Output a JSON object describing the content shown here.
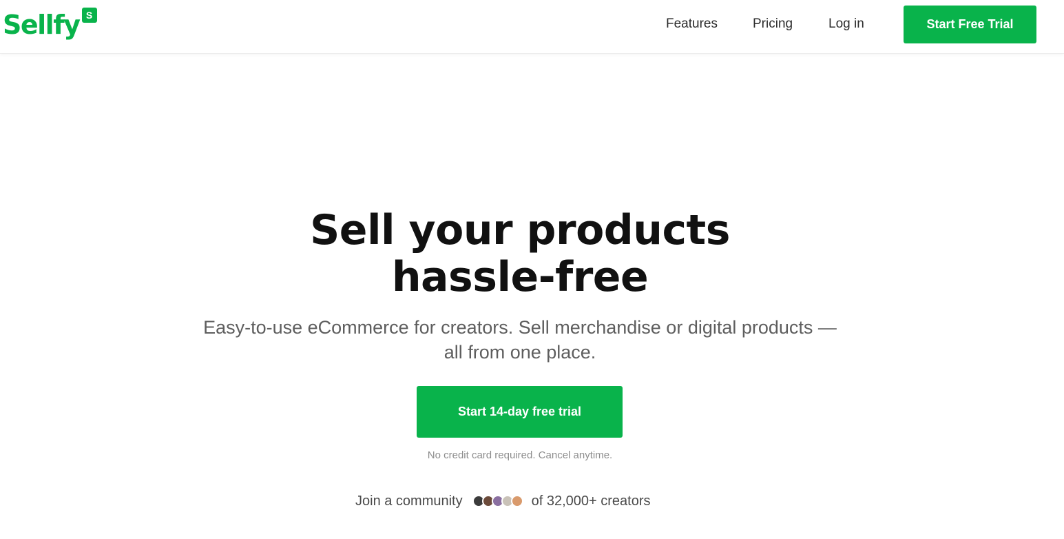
{
  "brand": {
    "name": "Sellfy",
    "badge": "S",
    "color": "#09b34b"
  },
  "nav": {
    "features": "Features",
    "pricing": "Pricing",
    "login": "Log in",
    "cta": "Start Free Trial"
  },
  "hero": {
    "title_line1": "Sell your products",
    "title_line2": "hassle-free",
    "subtitle": "Easy-to-use eCommerce for creators. Sell merchandise or digital products — all from one place.",
    "cta": "Start 14-day free trial",
    "fineprint": "No credit card required. Cancel anytime."
  },
  "community": {
    "prefix": "Join a community",
    "suffix": "of 32,000+ creators",
    "avatars": [
      "creator-avatar-1",
      "creator-avatar-2",
      "creator-avatar-3",
      "creator-avatar-4",
      "creator-avatar-5"
    ]
  }
}
